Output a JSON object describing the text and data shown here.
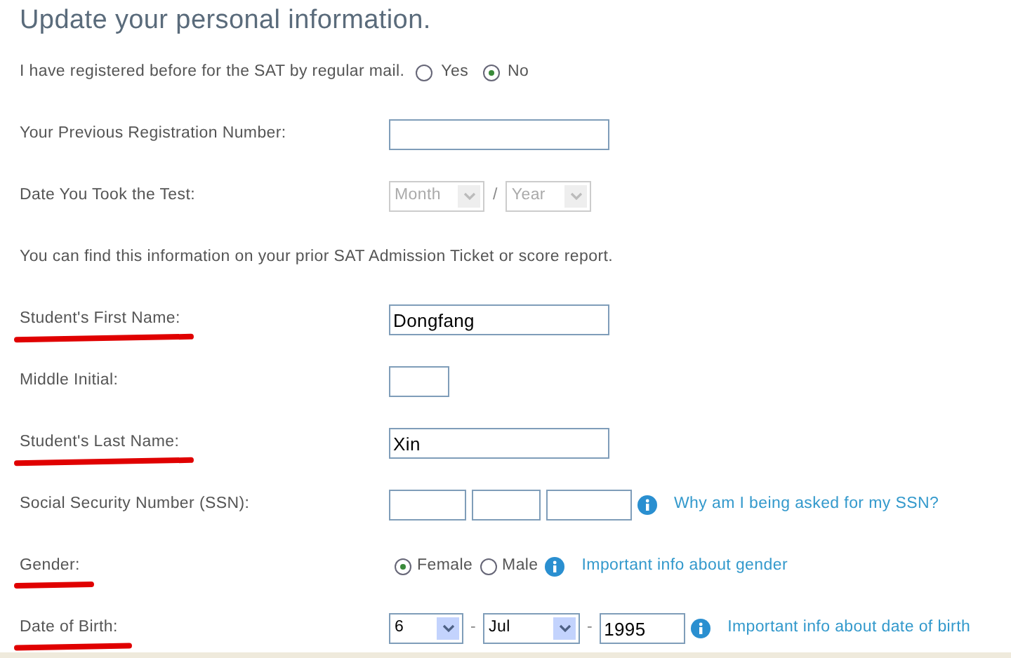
{
  "title": "Update your personal information.",
  "registered_before": {
    "label": "I have registered before for the SAT by regular mail.",
    "options": [
      {
        "label": "Yes",
        "selected": false
      },
      {
        "label": "No",
        "selected": true
      }
    ]
  },
  "fields": [
    {
      "kind": "text",
      "label": "Your Previous Registration Number:",
      "marked": false
    },
    {
      "kind": "month_year",
      "label": "Date You Took the Test:",
      "marked": false,
      "month": {
        "value": "Month",
        "disabled": true
      },
      "separator": "/",
      "year": {
        "value": "Year",
        "disabled": true
      }
    },
    {
      "kind": "note",
      "text": "You can find this information on your prior SAT Admission Ticket or score report."
    },
    {
      "kind": "text",
      "label": "Student's First Name:",
      "marked": true,
      "value": "Dongfang"
    },
    {
      "kind": "initial",
      "label": "Middle Initial:",
      "marked": false
    },
    {
      "kind": "text",
      "label": "Student's Last Name:",
      "marked": true,
      "value": "Xin"
    },
    {
      "kind": "ssn",
      "label": "Social Security Number (SSN):",
      "marked": false,
      "link": "Why am I being asked for my SSN?"
    },
    {
      "kind": "radio",
      "label": "Gender:",
      "marked": true,
      "options": [
        {
          "label": "Female",
          "selected": true
        },
        {
          "label": "Male",
          "selected": false
        }
      ],
      "link": "Important info about gender"
    },
    {
      "kind": "date",
      "label": "Date of Birth:",
      "marked": true,
      "day": "6",
      "separator_1": "-",
      "month": "Jul",
      "separator_2": "-",
      "year": "1995",
      "link": "Important info about date of birth"
    }
  ]
}
